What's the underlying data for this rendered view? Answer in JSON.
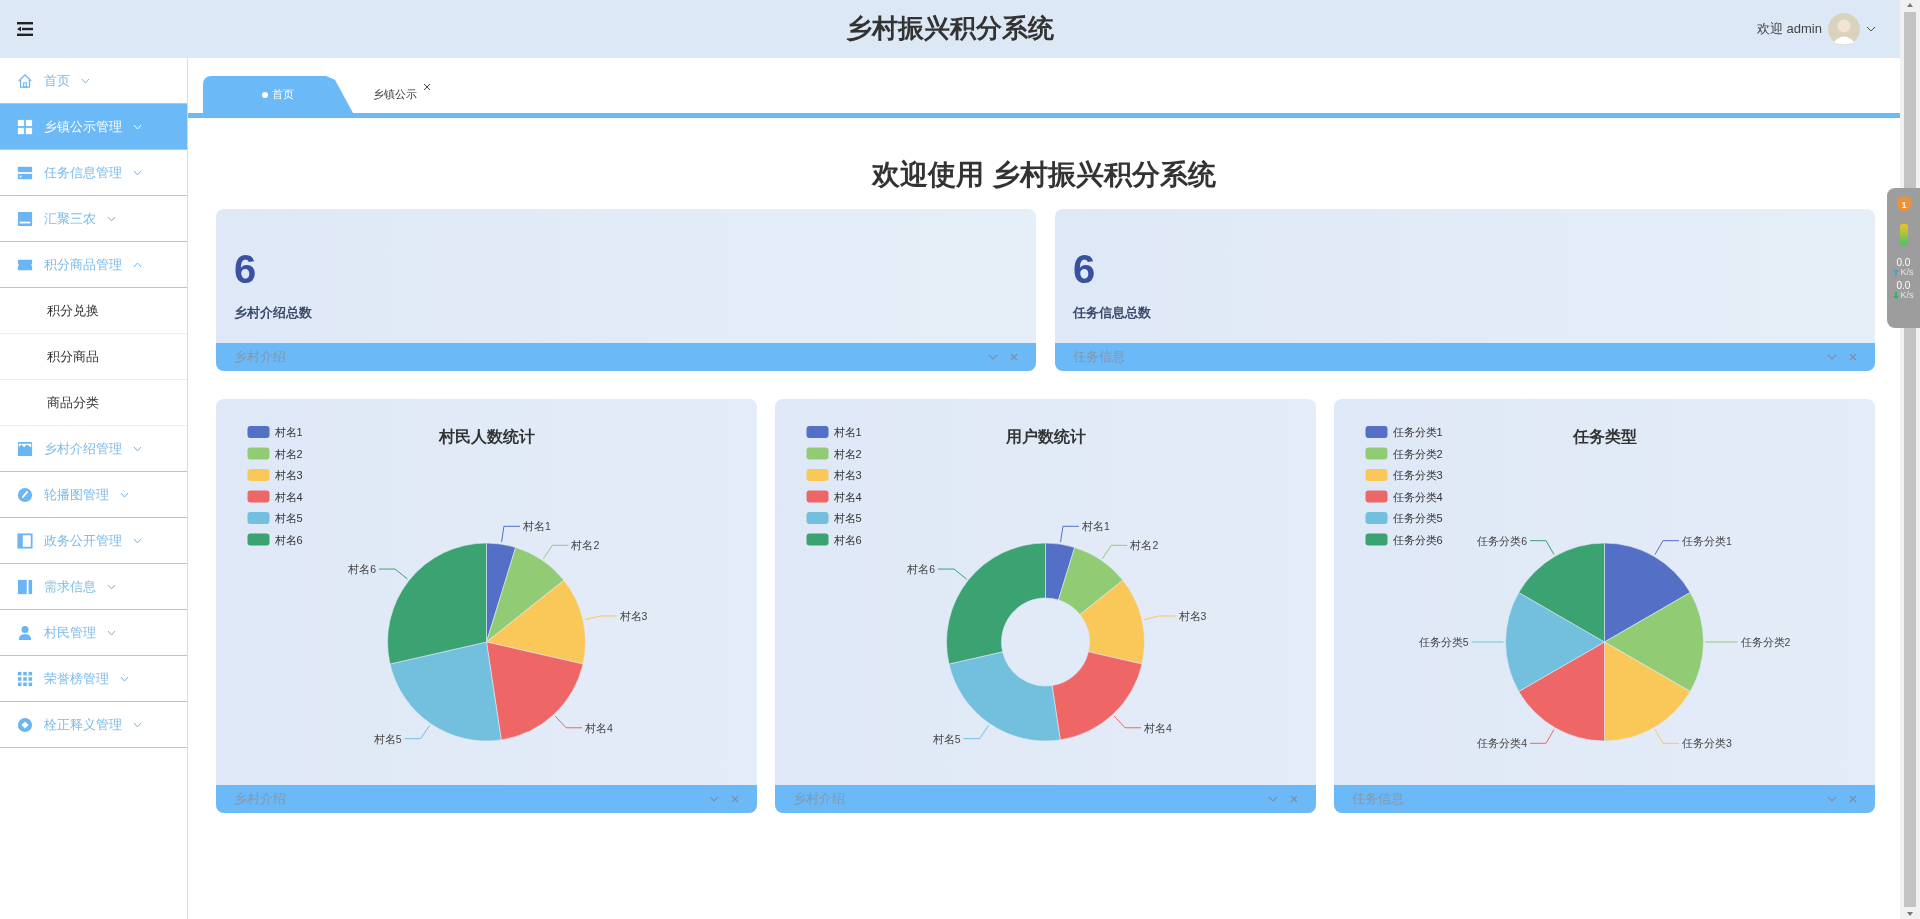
{
  "header": {
    "title": "乡村振兴积分系统",
    "welcome": "欢迎 admin"
  },
  "sidebar": {
    "items": [
      {
        "label": "首页",
        "selected": false,
        "expanded": false
      },
      {
        "label": "乡镇公示管理",
        "selected": true,
        "expanded": false
      },
      {
        "label": "任务信息管理",
        "selected": false,
        "expanded": false
      },
      {
        "label": "汇聚三农",
        "selected": false,
        "expanded": false
      },
      {
        "label": "积分商品管理",
        "selected": false,
        "expanded": true,
        "children": [
          {
            "label": "积分兑换",
            "selected": false
          },
          {
            "label": "积分商品",
            "selected": false
          },
          {
            "label": "商品分类",
            "selected": false
          }
        ]
      },
      {
        "label": "乡村介绍管理",
        "selected": false,
        "expanded": false
      },
      {
        "label": "轮播图管理",
        "selected": false,
        "expanded": false
      },
      {
        "label": "政务公开管理",
        "selected": false,
        "expanded": false
      },
      {
        "label": "需求信息",
        "selected": false,
        "expanded": false
      },
      {
        "label": "村民管理",
        "selected": false,
        "expanded": false
      },
      {
        "label": "荣誉榜管理",
        "selected": false,
        "expanded": false
      },
      {
        "label": "栓正释义管理",
        "selected": false,
        "expanded": false
      }
    ]
  },
  "tabs": [
    {
      "label": "首页",
      "selected": true,
      "closable": false
    },
    {
      "label": "乡镇公示",
      "selected": false,
      "closable": true
    }
  ],
  "page_title": "欢迎使用 乡村振兴积分系统",
  "stat_cards": [
    {
      "value": "6",
      "label": "乡村介绍总数",
      "footer": "乡村介绍"
    },
    {
      "value": "6",
      "label": "任务信息总数",
      "footer": "任务信息"
    }
  ],
  "chart_cards": [
    {
      "title": "村民人数统计",
      "kind": "pie",
      "legend": [
        {
          "label": "村名1",
          "color": "#5470c6"
        },
        {
          "label": "村名2",
          "color": "#91cc75"
        },
        {
          "label": "村名3",
          "color": "#fac858"
        },
        {
          "label": "村名4",
          "color": "#ee6666"
        },
        {
          "label": "村名5",
          "color": "#73c0de"
        },
        {
          "label": "村名6",
          "color": "#3ba272"
        }
      ],
      "slice_labels": [
        "村名1",
        "村名2",
        "村名3",
        "村名4",
        "村名5",
        "村名6"
      ],
      "footer": "乡村介绍"
    },
    {
      "title": "用户数统计",
      "kind": "donut",
      "legend": [
        {
          "label": "村名1",
          "color": "#5470c6"
        },
        {
          "label": "村名2",
          "color": "#91cc75"
        },
        {
          "label": "村名3",
          "color": "#fac858"
        },
        {
          "label": "村名4",
          "color": "#ee6666"
        },
        {
          "label": "村名5",
          "color": "#73c0de"
        },
        {
          "label": "村名6",
          "color": "#3ba272"
        }
      ],
      "slice_labels": [
        "村名1",
        "村名2",
        "村名3",
        "村名4",
        "村名5",
        "村名6"
      ],
      "footer": "乡村介绍"
    },
    {
      "title": "任务类型",
      "kind": "pie",
      "legend": [
        {
          "label": "任务分类1",
          "color": "#5470c6"
        },
        {
          "label": "任务分类2",
          "color": "#91cc75"
        },
        {
          "label": "任务分类3",
          "color": "#fac858"
        },
        {
          "label": "任务分类4",
          "color": "#ee6666"
        },
        {
          "label": "任务分类5",
          "color": "#73c0de"
        },
        {
          "label": "任务分类6",
          "color": "#3ba272"
        }
      ],
      "slice_labels": [
        "任务分类1",
        "任务分类2",
        "任务分类3",
        "任务分类4",
        "任务分类5",
        "任务分类6"
      ],
      "footer": "任务信息"
    }
  ],
  "speed_monitor": {
    "badge": "1",
    "readings": [
      {
        "kind": "up",
        "value": "0.0",
        "unit": "K/s"
      },
      {
        "kind": "down",
        "value": "0.0",
        "unit": "K/s"
      }
    ]
  }
}
